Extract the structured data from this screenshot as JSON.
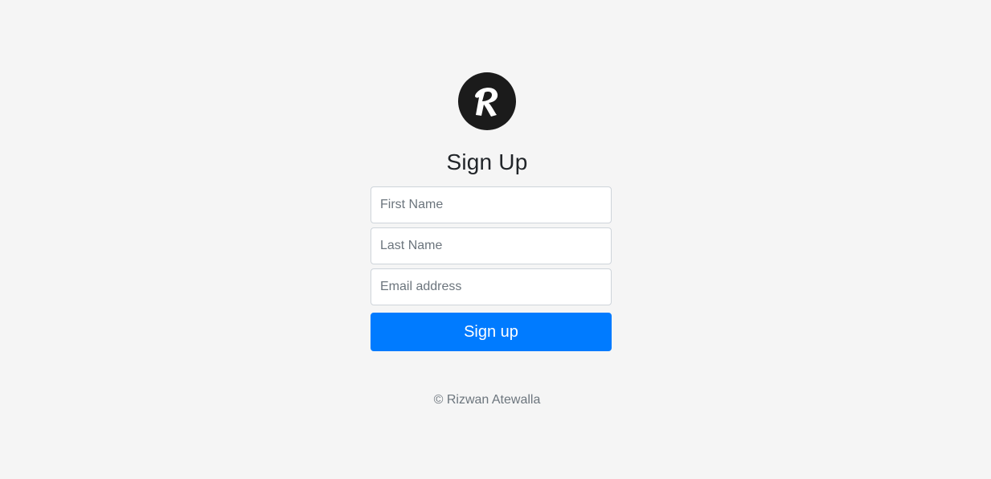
{
  "logo": {
    "icon": "r-logo-icon",
    "letter": "R",
    "bg_color": "#1b1b1b",
    "letter_color": "#ffffff"
  },
  "form": {
    "title": "Sign Up",
    "first_name_placeholder": "First Name",
    "first_name_value": "",
    "last_name_placeholder": "Last Name",
    "last_name_value": "",
    "email_placeholder": "Email address",
    "email_value": "",
    "submit_label": "Sign up",
    "accent_color": "#007bff"
  },
  "footer": {
    "copyright": "© Rizwan Atewalla"
  }
}
